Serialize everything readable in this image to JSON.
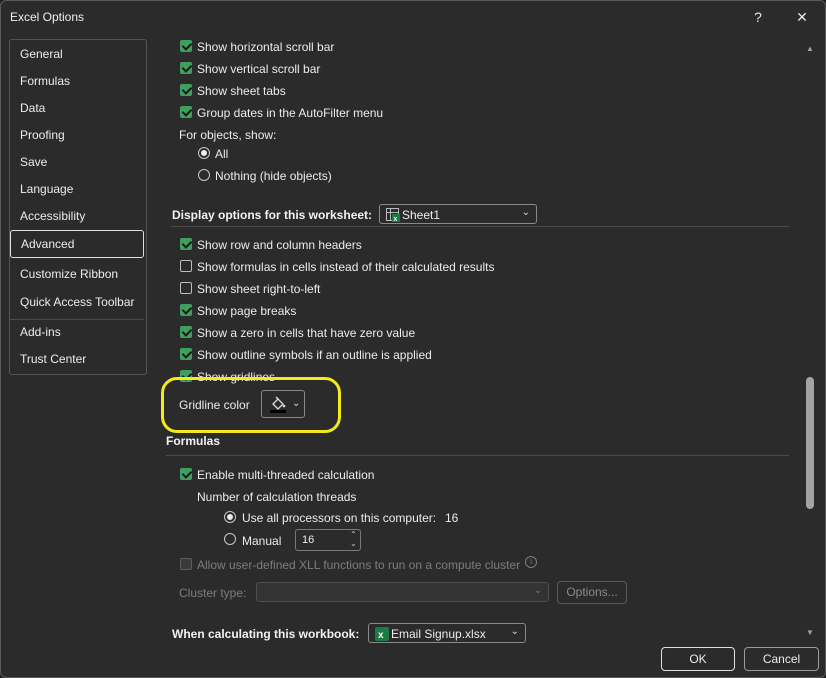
{
  "window": {
    "title": "Excel Options",
    "help_glyph": "?",
    "close_glyph": "✕"
  },
  "sidebar": {
    "items": [
      {
        "label": "General"
      },
      {
        "label": "Formulas"
      },
      {
        "label": "Data"
      },
      {
        "label": "Proofing"
      },
      {
        "label": "Save"
      },
      {
        "label": "Language"
      },
      {
        "label": "Accessibility"
      },
      {
        "label": "Advanced"
      },
      {
        "label": "Customize Ribbon"
      },
      {
        "label": "Quick Access Toolbar"
      },
      {
        "label": "Add-ins"
      },
      {
        "label": "Trust Center"
      }
    ],
    "active": "Advanced"
  },
  "workbook_opts": {
    "hscroll": "Show horizontal scroll bar",
    "vscroll": "Show vertical scroll bar",
    "sheet_tabs": "Show sheet tabs",
    "group_dates": "Group dates in the AutoFilter menu",
    "objects_label": "For objects, show:",
    "obj_all": "All",
    "obj_nothing": "Nothing (hide objects)"
  },
  "worksheet_opts": {
    "heading": "Display options for this worksheet:",
    "sheet_combo": "Sheet1",
    "row_col_headers": "Show row and column headers",
    "formulas_in_cells": "Show formulas in cells instead of their calculated results",
    "right_to_left": "Show sheet right-to-left",
    "page_breaks": "Show page breaks",
    "zero_values": "Show a zero in cells that have zero value",
    "outline_symbols": "Show outline symbols if an outline is applied",
    "gridlines": "Show gridlines",
    "gridline_color_label": "Gridline color"
  },
  "formulas": {
    "heading": "Formulas",
    "multithreaded": "Enable multi-threaded calculation",
    "threads_label": "Number of calculation threads",
    "use_all": "Use all processors on this computer:",
    "use_all_count": "16",
    "manual": "Manual",
    "manual_value": "16",
    "xll": "Allow user-defined XLL functions to run on a compute cluster",
    "cluster_type": "Cluster type:",
    "options_btn": "Options...",
    "calc_workbook": "When calculating this workbook:",
    "workbook_combo": "Email Signup.xlsx"
  },
  "footer": {
    "ok": "OK",
    "cancel": "Cancel"
  },
  "colors": {
    "accent_check": "#3f9f5f",
    "highlight": "#f2ea1a",
    "excel_green": "#1d7a45"
  }
}
